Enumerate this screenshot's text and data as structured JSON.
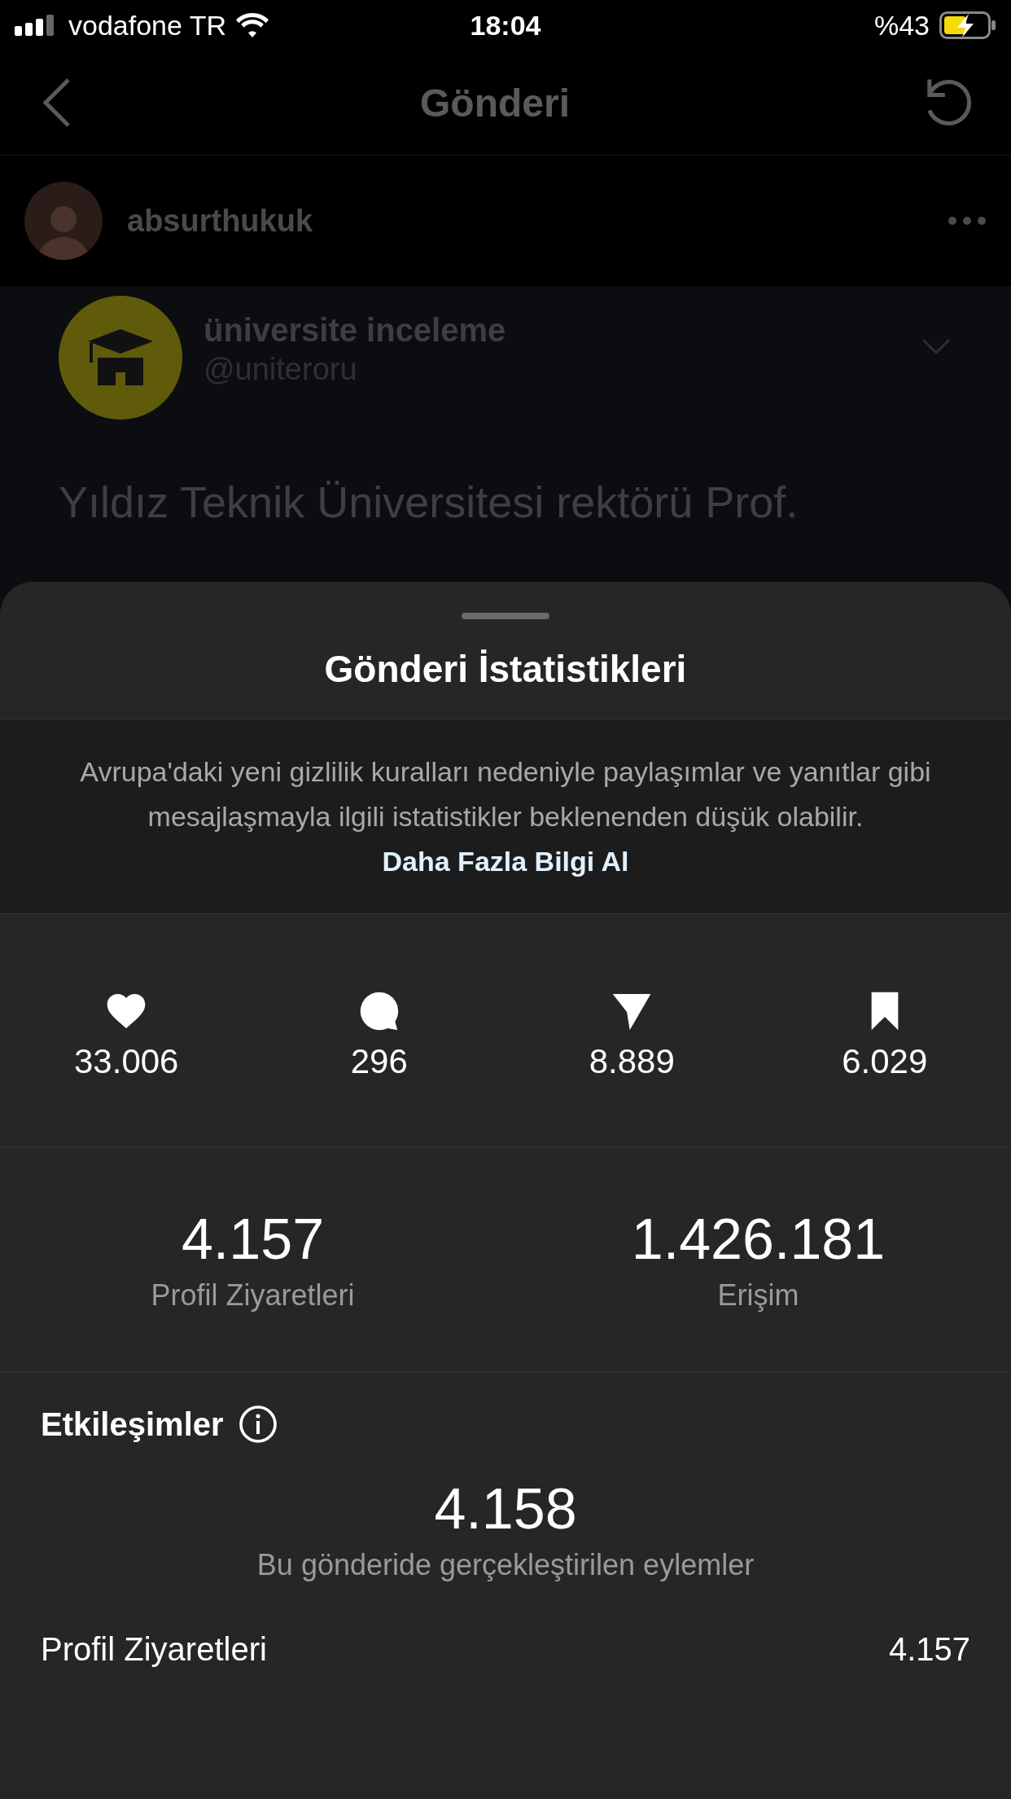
{
  "status_bar": {
    "carrier": "vodafone TR",
    "time": "18:04",
    "battery": "%43"
  },
  "nav": {
    "title": "Gönderi"
  },
  "post": {
    "username": "absurthukuk",
    "tweet": {
      "name": "üniversite inceleme",
      "handle": "@uniteroru",
      "text": "Yıldız Teknik Üniversitesi rektörü Prof."
    }
  },
  "sheet": {
    "title": "Gönderi İstatistikleri",
    "notice": {
      "text": "Avrupa'daki yeni gizlilik kuralları nedeniyle paylaşımlar ve yanıtlar gibi mesajlaşmayla ilgili istatistikler beklenenden düşük olabilir.",
      "link": "Daha Fazla Bilgi Al"
    },
    "stats": [
      {
        "kind": "likes",
        "value": "33.006"
      },
      {
        "kind": "comments",
        "value": "296"
      },
      {
        "kind": "shares",
        "value": "8.889"
      },
      {
        "kind": "saves",
        "value": "6.029"
      }
    ],
    "summary": [
      {
        "value": "4.157",
        "label": "Profil Ziyaretleri"
      },
      {
        "value": "1.426.181",
        "label": "Erişim"
      }
    ],
    "interactions": {
      "title": "Etkileşimler",
      "value": "4.158",
      "label": "Bu gönderide gerçekleştirilen eylemler",
      "rows": [
        {
          "label": "Profil Ziyaretleri",
          "value": "4.157"
        }
      ]
    }
  }
}
